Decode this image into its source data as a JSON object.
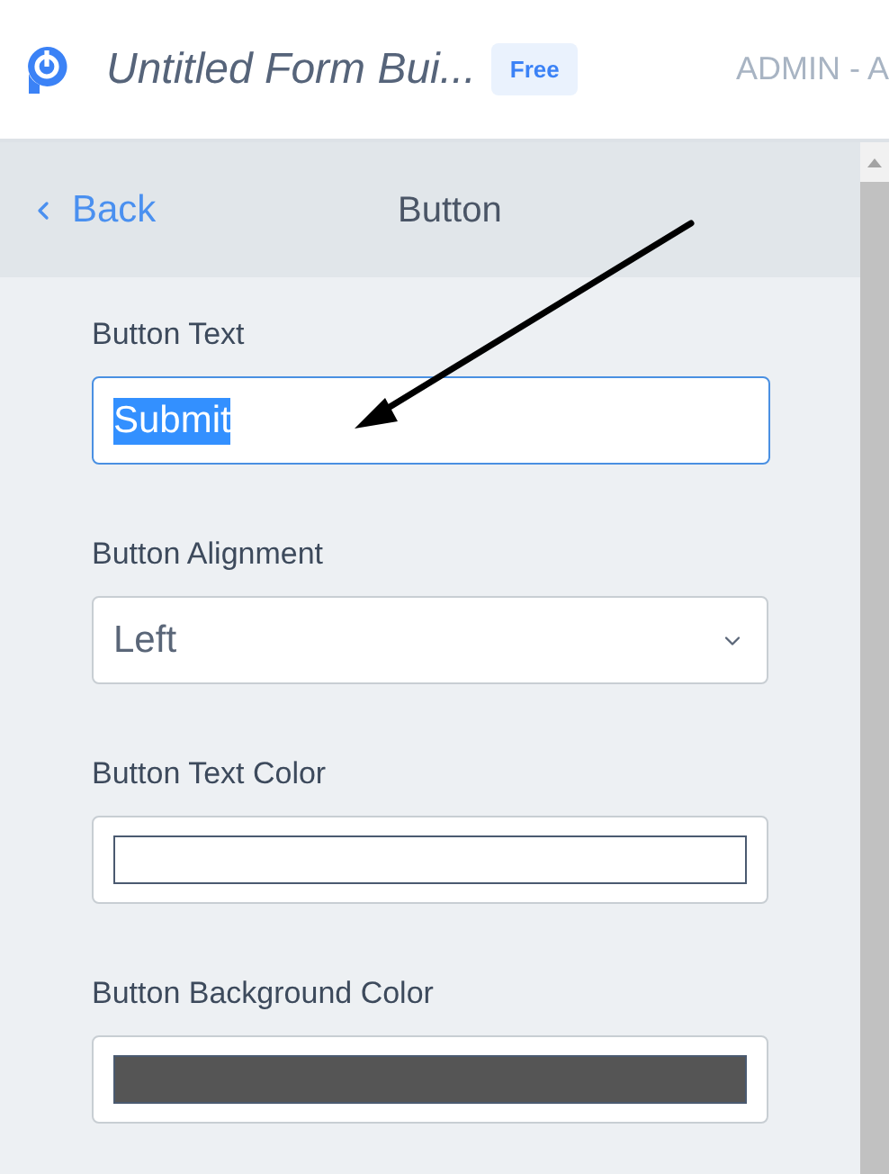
{
  "header": {
    "title": "Untitled Form Bui...",
    "badge": "Free",
    "user": "ADMIN - A"
  },
  "panel": {
    "back": "Back",
    "title": "Button"
  },
  "fields": [
    {
      "kind": "text",
      "label": "Button Text",
      "value": "Submit",
      "text_selected": true
    },
    {
      "kind": "select",
      "label": "Button Alignment",
      "value": "Left"
    },
    {
      "kind": "color",
      "label": "Button Text Color",
      "color": "#ffffff"
    },
    {
      "kind": "color",
      "label": "Button Background Color",
      "color": "#555555"
    }
  ]
}
